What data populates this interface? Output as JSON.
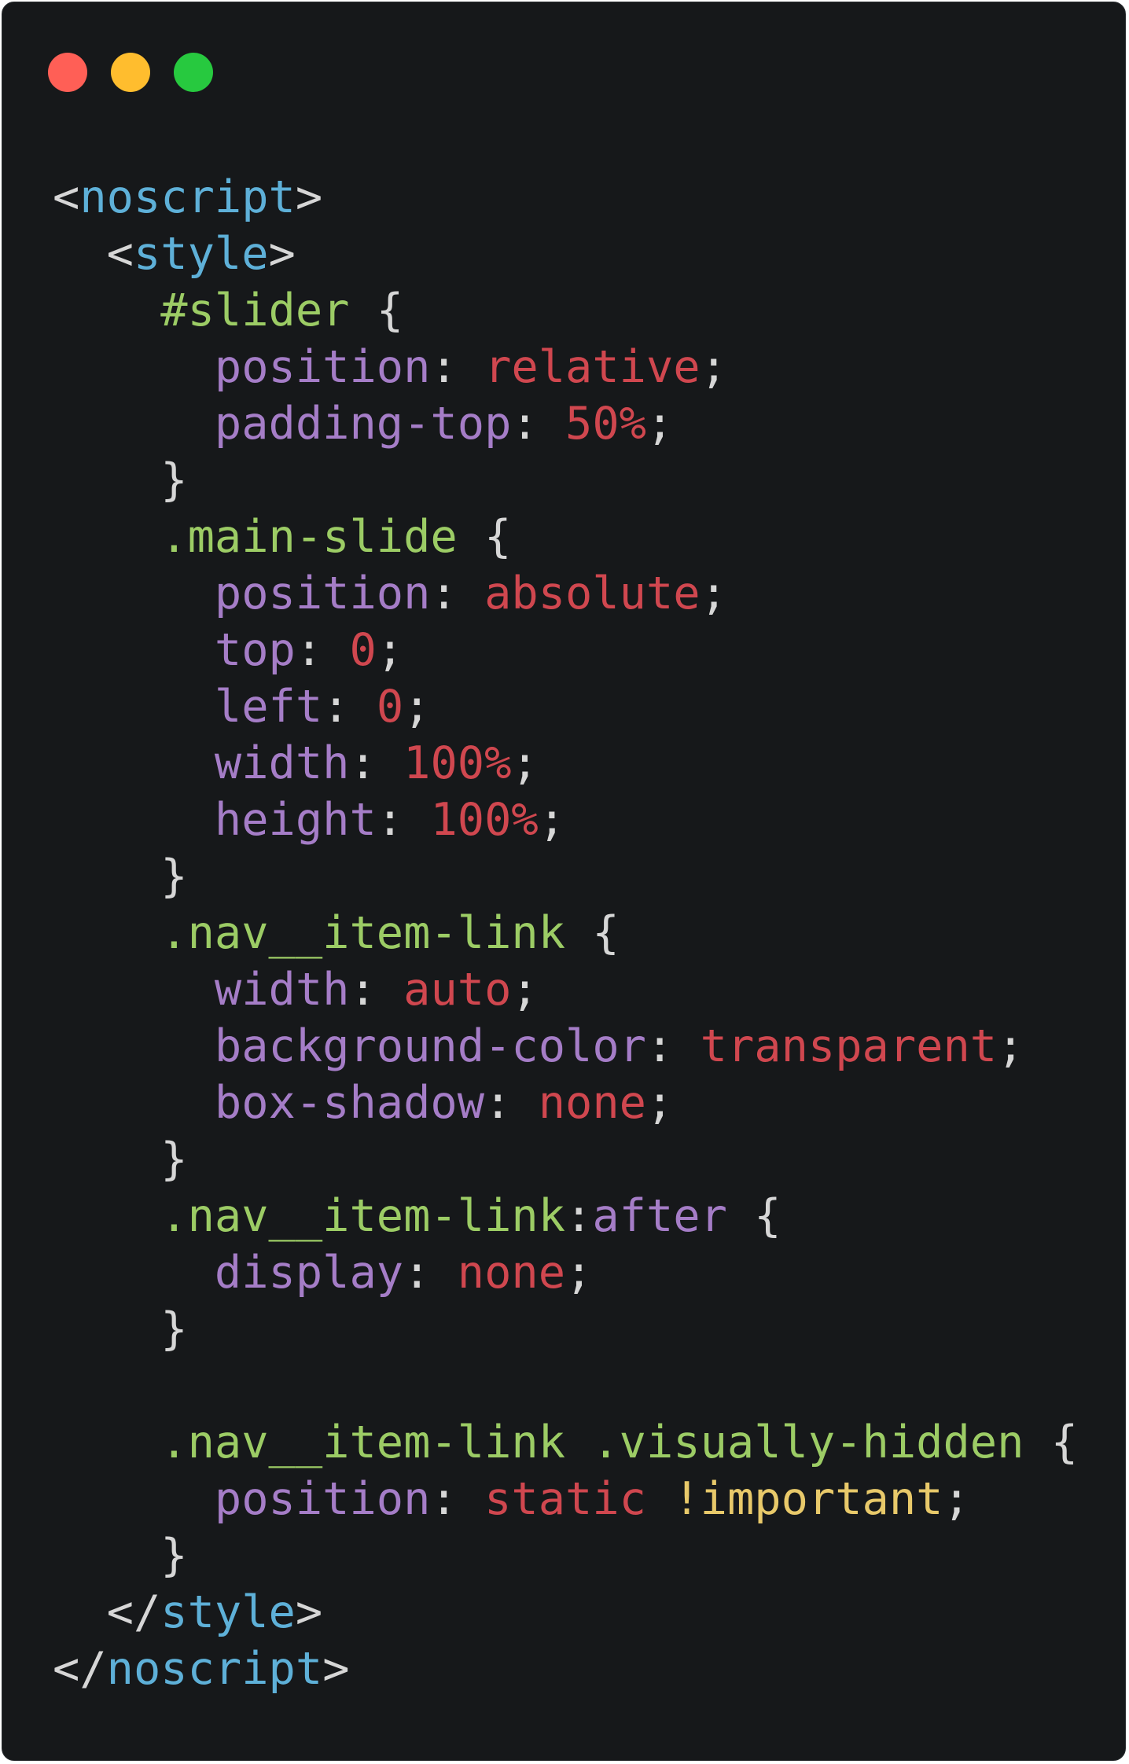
{
  "window": {
    "traffic_lights": [
      {
        "name": "close",
        "color": "#ff5f56"
      },
      {
        "name": "minimize",
        "color": "#ffbd2e"
      },
      {
        "name": "maximize",
        "color": "#27c93f"
      }
    ]
  },
  "colors": {
    "background": "#16181a",
    "punctuation": "#d6d6d6",
    "tag": "#5eb0d8",
    "selector": "#9ccc65",
    "property": "#a57dc7",
    "value": "#d0474f",
    "important": "#e8c96a"
  },
  "code_lines": [
    [
      {
        "t": "<",
        "k": "punctuation"
      },
      {
        "t": "noscript",
        "k": "tag"
      },
      {
        "t": ">",
        "k": "punctuation"
      }
    ],
    [
      {
        "t": "  <",
        "k": "punctuation"
      },
      {
        "t": "style",
        "k": "tag"
      },
      {
        "t": ">",
        "k": "punctuation"
      }
    ],
    [
      {
        "t": "    #slider",
        "k": "selector"
      },
      {
        "t": " {",
        "k": "punctuation"
      }
    ],
    [
      {
        "t": "      position",
        "k": "property"
      },
      {
        "t": ": ",
        "k": "punctuation"
      },
      {
        "t": "relative",
        "k": "value"
      },
      {
        "t": ";",
        "k": "punctuation"
      }
    ],
    [
      {
        "t": "      padding-top",
        "k": "property"
      },
      {
        "t": ": ",
        "k": "punctuation"
      },
      {
        "t": "50%",
        "k": "value"
      },
      {
        "t": ";",
        "k": "punctuation"
      }
    ],
    [
      {
        "t": "    }",
        "k": "punctuation"
      }
    ],
    [
      {
        "t": "    .main-slide",
        "k": "selector"
      },
      {
        "t": " {",
        "k": "punctuation"
      }
    ],
    [
      {
        "t": "      position",
        "k": "property"
      },
      {
        "t": ": ",
        "k": "punctuation"
      },
      {
        "t": "absolute",
        "k": "value"
      },
      {
        "t": ";",
        "k": "punctuation"
      }
    ],
    [
      {
        "t": "      top",
        "k": "property"
      },
      {
        "t": ": ",
        "k": "punctuation"
      },
      {
        "t": "0",
        "k": "value"
      },
      {
        "t": ";",
        "k": "punctuation"
      }
    ],
    [
      {
        "t": "      left",
        "k": "property"
      },
      {
        "t": ": ",
        "k": "punctuation"
      },
      {
        "t": "0",
        "k": "value"
      },
      {
        "t": ";",
        "k": "punctuation"
      }
    ],
    [
      {
        "t": "      width",
        "k": "property"
      },
      {
        "t": ": ",
        "k": "punctuation"
      },
      {
        "t": "100%",
        "k": "value"
      },
      {
        "t": ";",
        "k": "punctuation"
      }
    ],
    [
      {
        "t": "      height",
        "k": "property"
      },
      {
        "t": ": ",
        "k": "punctuation"
      },
      {
        "t": "100%",
        "k": "value"
      },
      {
        "t": ";",
        "k": "punctuation"
      }
    ],
    [
      {
        "t": "    }",
        "k": "punctuation"
      }
    ],
    [
      {
        "t": "    .nav__item-link",
        "k": "selector"
      },
      {
        "t": " {",
        "k": "punctuation"
      }
    ],
    [
      {
        "t": "      width",
        "k": "property"
      },
      {
        "t": ": ",
        "k": "punctuation"
      },
      {
        "t": "auto",
        "k": "value"
      },
      {
        "t": ";",
        "k": "punctuation"
      }
    ],
    [
      {
        "t": "      background-color",
        "k": "property"
      },
      {
        "t": ": ",
        "k": "punctuation"
      },
      {
        "t": "transparent",
        "k": "value"
      },
      {
        "t": ";",
        "k": "punctuation"
      }
    ],
    [
      {
        "t": "      box-shadow",
        "k": "property"
      },
      {
        "t": ": ",
        "k": "punctuation"
      },
      {
        "t": "none",
        "k": "value"
      },
      {
        "t": ";",
        "k": "punctuation"
      }
    ],
    [
      {
        "t": "    }",
        "k": "punctuation"
      }
    ],
    [
      {
        "t": "    .nav__item-link",
        "k": "selector"
      },
      {
        "t": ":",
        "k": "punctuation"
      },
      {
        "t": "after",
        "k": "property"
      },
      {
        "t": " {",
        "k": "punctuation"
      }
    ],
    [
      {
        "t": "      display",
        "k": "property"
      },
      {
        "t": ": ",
        "k": "punctuation"
      },
      {
        "t": "none",
        "k": "value"
      },
      {
        "t": ";",
        "k": "punctuation"
      }
    ],
    [
      {
        "t": "    }",
        "k": "punctuation"
      }
    ],
    [],
    [
      {
        "t": "    .nav__item-link .visually-hidden",
        "k": "selector"
      },
      {
        "t": " {",
        "k": "punctuation"
      }
    ],
    [
      {
        "t": "      position",
        "k": "property"
      },
      {
        "t": ": ",
        "k": "punctuation"
      },
      {
        "t": "static",
        "k": "value"
      },
      {
        "t": " ",
        "k": "punctuation"
      },
      {
        "t": "!important",
        "k": "important"
      },
      {
        "t": ";",
        "k": "punctuation"
      }
    ],
    [
      {
        "t": "    }",
        "k": "punctuation"
      }
    ],
    [
      {
        "t": "  </",
        "k": "punctuation"
      },
      {
        "t": "style",
        "k": "tag"
      },
      {
        "t": ">",
        "k": "punctuation"
      }
    ],
    [
      {
        "t": "</",
        "k": "punctuation"
      },
      {
        "t": "noscript",
        "k": "tag"
      },
      {
        "t": ">",
        "k": "punctuation"
      }
    ]
  ]
}
